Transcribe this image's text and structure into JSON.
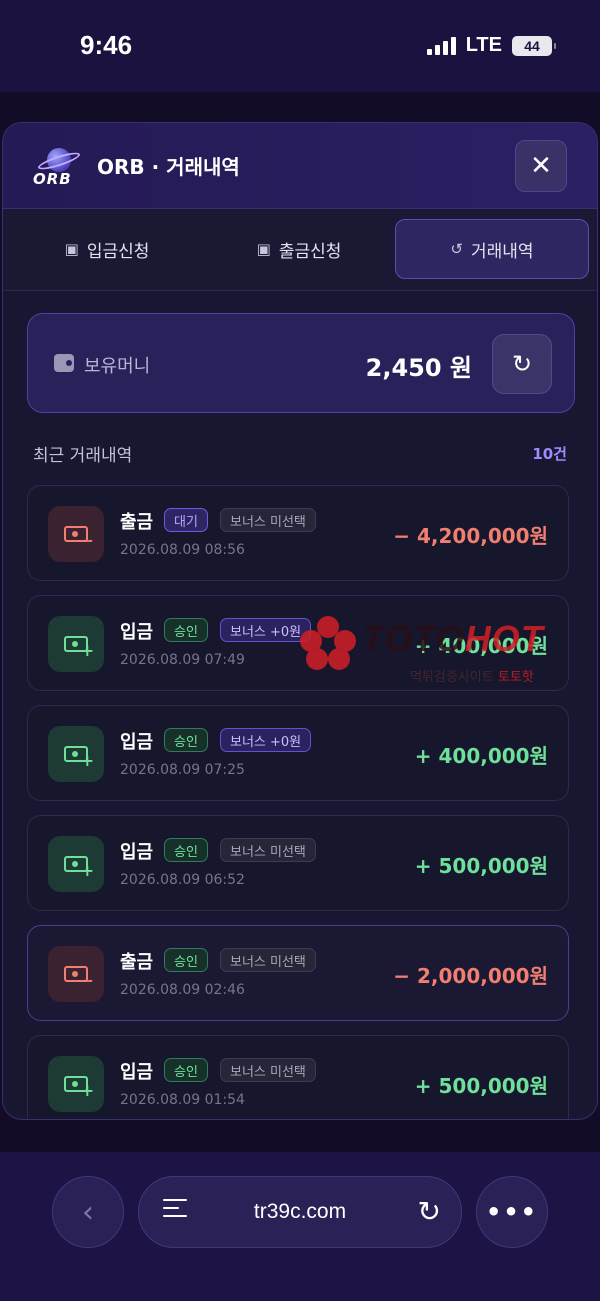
{
  "status_bar": {
    "time": "9:46",
    "network": "LTE",
    "battery": "44"
  },
  "modal": {
    "title": "ORB · 거래내역",
    "logo_text": "ORB"
  },
  "tabs": [
    {
      "label": "입금신청",
      "icon": "deposit-icon"
    },
    {
      "label": "출금신청",
      "icon": "withdraw-icon"
    },
    {
      "label": "거래내역",
      "icon": "history-icon",
      "active": true
    }
  ],
  "balance": {
    "label": "보유머니",
    "amount": "2,450 원"
  },
  "history": {
    "title": "최근 거래내역",
    "count": "10건",
    "items": [
      {
        "type": "출금",
        "status": "대기",
        "bonus": "보너스 미선택",
        "date": "2026.08.09 08:56",
        "amount": "− 4,200,000원",
        "kind": "out"
      },
      {
        "type": "입금",
        "status": "승인",
        "bonus": "보너스 +0원",
        "date": "2026.08.09 07:49",
        "amount": "+ 400,000원",
        "kind": "in"
      },
      {
        "type": "입금",
        "status": "승인",
        "bonus": "보너스 +0원",
        "date": "2026.08.09 07:25",
        "amount": "+ 400,000원",
        "kind": "in"
      },
      {
        "type": "입금",
        "status": "승인",
        "bonus": "보너스 미선택",
        "date": "2026.08.09 06:52",
        "amount": "+ 500,000원",
        "kind": "in"
      },
      {
        "type": "출금",
        "status": "승인",
        "bonus": "보너스 미선택",
        "date": "2026.08.09 02:46",
        "amount": "− 2,000,000원",
        "kind": "out"
      },
      {
        "type": "입금",
        "status": "승인",
        "bonus": "보너스 미선택",
        "date": "2026.08.09 01:54",
        "amount": "+ 500,000원",
        "kind": "in"
      }
    ]
  },
  "watermark": {
    "brand_a": "TOTO",
    "brand_b": "HOT",
    "sub_a": "먹튀검증사이트",
    "sub_b": "토토핫"
  },
  "browser": {
    "url": "tr39c.com"
  }
}
